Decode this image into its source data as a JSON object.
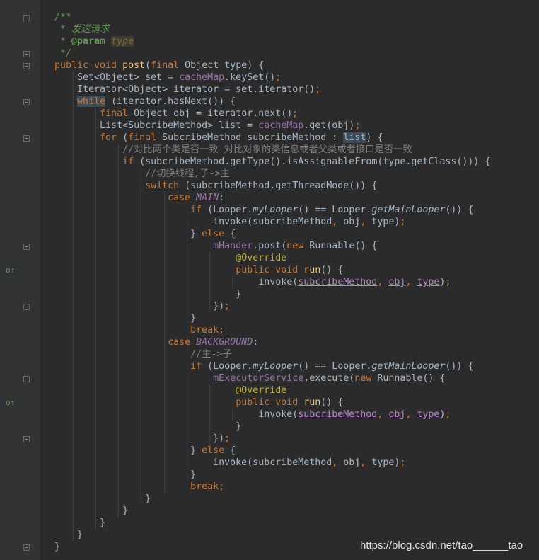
{
  "watermark": "https://blog.csdn.net/tao______tao",
  "gutter": {
    "fold_icon": "fold-marker-icon",
    "override_icon": "override-method-icon",
    "override_marks": [
      "o↑",
      "o↑"
    ]
  },
  "code": [
    [
      [
        "doc",
        "/**"
      ]
    ],
    [
      [
        "doc",
        " * 发送请求"
      ]
    ],
    [
      [
        "doc",
        " * "
      ],
      [
        "doctag",
        "@param"
      ],
      [
        "doc",
        " "
      ],
      [
        "docparam",
        "type"
      ]
    ],
    [
      [
        "doc",
        " */"
      ]
    ],
    [
      [
        "kw",
        "public void "
      ],
      [
        "fn",
        "post"
      ],
      [
        "",
        "("
      ],
      [
        "kw",
        "final "
      ],
      [
        "",
        "Object type) {"
      ]
    ],
    [
      [
        "",
        "    Set<Object> set = "
      ],
      [
        "field",
        "cacheMap"
      ],
      [
        "",
        ".keySet()"
      ],
      [
        "kw",
        ";"
      ]
    ],
    [
      [
        "",
        "    Iterator<Object> iterator = set.iterator()"
      ],
      [
        "kw",
        ";"
      ]
    ],
    [
      [
        "",
        "    "
      ],
      [
        "kw hl",
        "while"
      ],
      [
        "",
        " (iterator.hasNext()) {"
      ]
    ],
    [
      [
        "",
        "        "
      ],
      [
        "kw",
        "final "
      ],
      [
        "",
        "Object obj = iterator.next()"
      ],
      [
        "kw",
        ";"
      ]
    ],
    [
      [
        "",
        "        List<SubcribeMethod> list = "
      ],
      [
        "field",
        "cacheMap"
      ],
      [
        "",
        ".get(obj)"
      ],
      [
        "kw",
        ";"
      ]
    ],
    [
      [
        "",
        "        "
      ],
      [
        "kw",
        "for "
      ],
      [
        "",
        "("
      ],
      [
        "kw",
        "final "
      ],
      [
        "",
        "SubcribeMethod subcribeMethod : "
      ],
      [
        "hl",
        "list"
      ],
      [
        "",
        ") {"
      ]
    ],
    [
      [
        "",
        "            "
      ],
      [
        "cmt",
        "//对比两个类是否一致 对比对象的类信息或者父类或者接口是否一致"
      ]
    ],
    [
      [
        "",
        "            "
      ],
      [
        "kw",
        "if "
      ],
      [
        "",
        "(subcribeMethod.getType().isAssignableFrom(type.getClass())) {"
      ]
    ],
    [
      [
        "",
        "                "
      ],
      [
        "cmt",
        "//切换线程,子->主"
      ]
    ],
    [
      [
        "",
        "                "
      ],
      [
        "kw",
        "switch "
      ],
      [
        "",
        "(subcribeMethod.getThreadMode()) {"
      ]
    ],
    [
      [
        "",
        "                    "
      ],
      [
        "kw",
        "case "
      ],
      [
        "static",
        "MAIN"
      ],
      [
        "",
        ":"
      ]
    ],
    [
      [
        "",
        "                        "
      ],
      [
        "kw",
        "if "
      ],
      [
        "",
        "(Looper."
      ],
      [
        "italic",
        "myLooper"
      ],
      [
        "",
        "() == Looper."
      ],
      [
        "italic",
        "getMainLooper"
      ],
      [
        "",
        "()) {"
      ]
    ],
    [
      [
        "",
        "                            invoke(subcribeMethod"
      ],
      [
        "kw",
        ", "
      ],
      [
        "",
        "obj"
      ],
      [
        "kw",
        ", "
      ],
      [
        "",
        "type)"
      ],
      [
        "kw",
        ";"
      ]
    ],
    [
      [
        "",
        "                        } "
      ],
      [
        "kw",
        "else "
      ],
      [
        "",
        "{"
      ]
    ],
    [
      [
        "",
        "                            "
      ],
      [
        "field",
        "mHander"
      ],
      [
        "",
        ".post("
      ],
      [
        "kw",
        "new "
      ],
      [
        "",
        "Runnable() {"
      ]
    ],
    [
      [
        "",
        "                                "
      ],
      [
        "ann",
        "@Override"
      ]
    ],
    [
      [
        "",
        "                                "
      ],
      [
        "kw",
        "public void "
      ],
      [
        "fn",
        "run"
      ],
      [
        "",
        "() {"
      ]
    ],
    [
      [
        "",
        "                                    invoke("
      ],
      [
        "cap",
        "subcribeMethod"
      ],
      [
        "kw",
        ", "
      ],
      [
        "cap",
        "obj"
      ],
      [
        "kw",
        ", "
      ],
      [
        "cap",
        "type"
      ],
      [
        "",
        ")"
      ],
      [
        "kw",
        ";"
      ]
    ],
    [
      [
        "",
        "                                }"
      ]
    ],
    [
      [
        "",
        "                            })"
      ],
      [
        "kw",
        ";"
      ]
    ],
    [
      [
        "",
        "                        }"
      ]
    ],
    [
      [
        "",
        "                        "
      ],
      [
        "kw",
        "break;"
      ]
    ],
    [
      [
        "",
        "                    "
      ],
      [
        "kw",
        "case "
      ],
      [
        "static",
        "BACKGROUND"
      ],
      [
        "",
        ":"
      ]
    ],
    [
      [
        "",
        "                        "
      ],
      [
        "cmt",
        "//主->子"
      ]
    ],
    [
      [
        "",
        "                        "
      ],
      [
        "kw",
        "if "
      ],
      [
        "",
        "(Looper."
      ],
      [
        "italic",
        "myLooper"
      ],
      [
        "",
        "() == Looper."
      ],
      [
        "italic",
        "getMainLooper"
      ],
      [
        "",
        "()) {"
      ]
    ],
    [
      [
        "",
        "                            "
      ],
      [
        "field",
        "mExecutorService"
      ],
      [
        "",
        ".execute("
      ],
      [
        "kw",
        "new "
      ],
      [
        "",
        "Runnable() {"
      ]
    ],
    [
      [
        "",
        "                                "
      ],
      [
        "ann",
        "@Override"
      ]
    ],
    [
      [
        "",
        "                                "
      ],
      [
        "kw",
        "public void "
      ],
      [
        "fn",
        "run"
      ],
      [
        "",
        "() {"
      ]
    ],
    [
      [
        "",
        "                                    invoke("
      ],
      [
        "cap",
        "subcribeMethod"
      ],
      [
        "kw",
        ", "
      ],
      [
        "cap",
        "obj"
      ],
      [
        "kw",
        ", "
      ],
      [
        "cap",
        "type"
      ],
      [
        "",
        ")"
      ],
      [
        "kw",
        ";"
      ]
    ],
    [
      [
        "",
        "                                }"
      ]
    ],
    [
      [
        "",
        "                            })"
      ],
      [
        "kw",
        ";"
      ]
    ],
    [
      [
        "",
        "                        } "
      ],
      [
        "kw",
        "else "
      ],
      [
        "",
        "{"
      ]
    ],
    [
      [
        "",
        "                            invoke(subcribeMethod"
      ],
      [
        "kw",
        ", "
      ],
      [
        "",
        "obj"
      ],
      [
        "kw",
        ", "
      ],
      [
        "",
        "type)"
      ],
      [
        "kw",
        ";"
      ]
    ],
    [
      [
        "",
        "                        }"
      ]
    ],
    [
      [
        "",
        "                        "
      ],
      [
        "kw",
        "break;"
      ]
    ],
    [
      [
        "",
        "                }"
      ]
    ],
    [
      [
        "",
        "            }"
      ]
    ],
    [
      [
        "",
        "        }"
      ]
    ],
    [
      [
        "",
        "    }"
      ]
    ],
    [
      [
        "",
        "}"
      ]
    ]
  ]
}
